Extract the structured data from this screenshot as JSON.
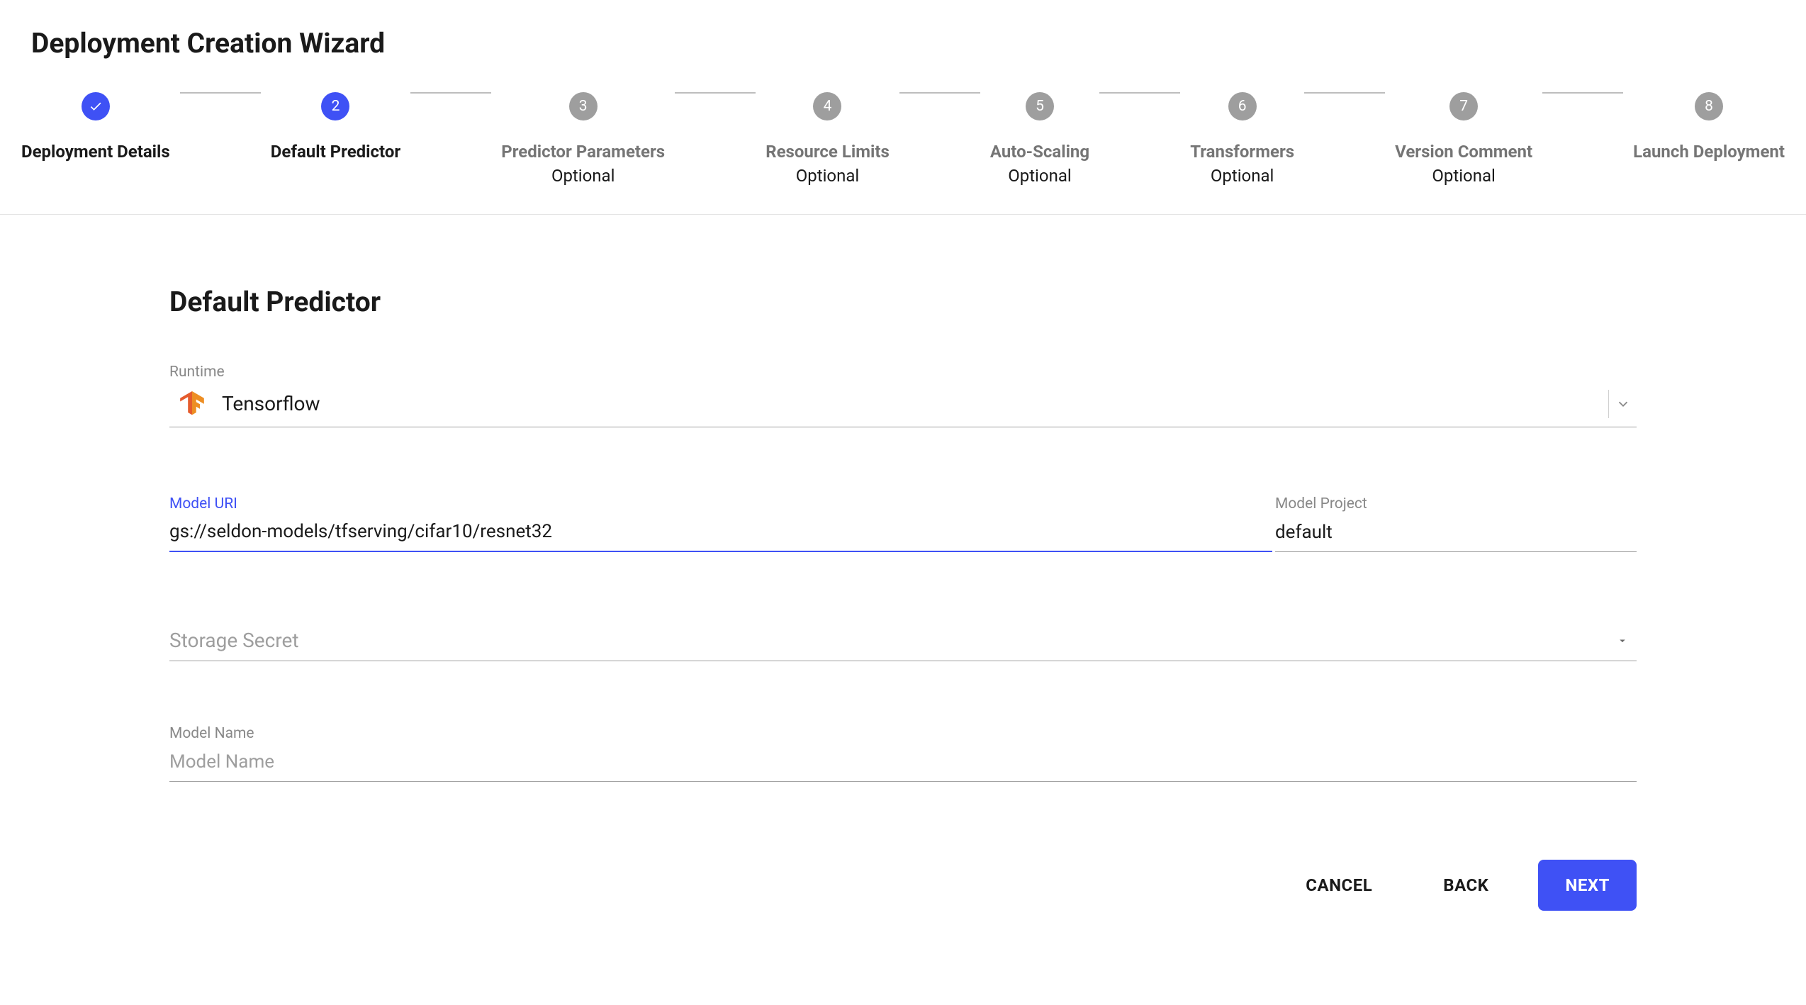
{
  "page_title": "Deployment Creation Wizard",
  "steps": [
    {
      "label": "Deployment Details",
      "sublabel": "",
      "state": "completed",
      "number": ""
    },
    {
      "label": "Default Predictor",
      "sublabel": "",
      "state": "active",
      "number": "2"
    },
    {
      "label": "Predictor Parameters",
      "sublabel": "Optional",
      "state": "inactive",
      "number": "3"
    },
    {
      "label": "Resource Limits",
      "sublabel": "Optional",
      "state": "inactive",
      "number": "4"
    },
    {
      "label": "Auto-Scaling",
      "sublabel": "Optional",
      "state": "inactive",
      "number": "5"
    },
    {
      "label": "Transformers",
      "sublabel": "Optional",
      "state": "inactive",
      "number": "6"
    },
    {
      "label": "Version Comment",
      "sublabel": "Optional",
      "state": "inactive",
      "number": "7"
    },
    {
      "label": "Launch Deployment",
      "sublabel": "",
      "state": "inactive",
      "number": "8"
    }
  ],
  "section_title": "Default Predictor",
  "runtime": {
    "label": "Runtime",
    "value": "Tensorflow",
    "icon": "tensorflow-icon"
  },
  "model_uri": {
    "label": "Model URI",
    "value": "gs://seldon-models/tfserving/cifar10/resnet32"
  },
  "model_project": {
    "label": "Model Project",
    "value": "default"
  },
  "storage_secret": {
    "placeholder": "Storage Secret",
    "value": ""
  },
  "model_name": {
    "label": "Model Name",
    "placeholder": "Model Name",
    "value": ""
  },
  "buttons": {
    "cancel": "CANCEL",
    "back": "BACK",
    "next": "NEXT"
  }
}
